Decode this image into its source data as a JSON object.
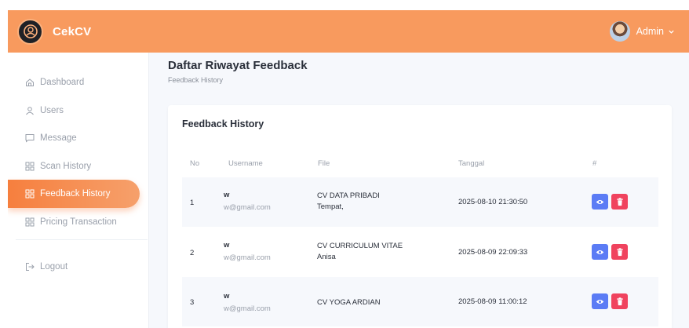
{
  "header": {
    "brand": "CekCV",
    "user_label": "Admin"
  },
  "sidebar": {
    "items": [
      {
        "label": "Dashboard",
        "icon": "home-icon"
      },
      {
        "label": "Users",
        "icon": "user-icon"
      },
      {
        "label": "Message",
        "icon": "message-icon"
      },
      {
        "label": "Scan History",
        "icon": "grid-icon"
      },
      {
        "label": "Feedback History",
        "icon": "grid-icon"
      },
      {
        "label": "Pricing Transaction",
        "icon": "grid-icon"
      }
    ],
    "active": "Feedback History",
    "logout": "Logout"
  },
  "page": {
    "title": "Daftar Riwayat Feedback",
    "subtitle": "Feedback History"
  },
  "card": {
    "title": "Feedback History",
    "columns": [
      "No",
      "Username",
      "File",
      "Tanggal",
      "#"
    ],
    "rows": [
      {
        "no": "1",
        "username": "w",
        "email": "w@gmail.com",
        "file_line1": "CV DATA PRIBADI",
        "file_line2": "Tempat,",
        "date": "2025-08-10 21:30:50"
      },
      {
        "no": "2",
        "username": "w",
        "email": "w@gmail.com",
        "file_line1": "CV CURRICULUM VITAE",
        "file_line2": "Anisa",
        "date": "2025-08-09 22:09:33"
      },
      {
        "no": "3",
        "username": "w",
        "email": "w@gmail.com",
        "file_line1": "CV YOGA ARDIAN",
        "file_line2": "",
        "date": "2025-08-09 11:00:12"
      }
    ]
  },
  "colors": {
    "header": "#f89a5e",
    "accent": "#f67f3e",
    "view_button": "#5b7cf5",
    "delete_button": "#f0435e"
  }
}
